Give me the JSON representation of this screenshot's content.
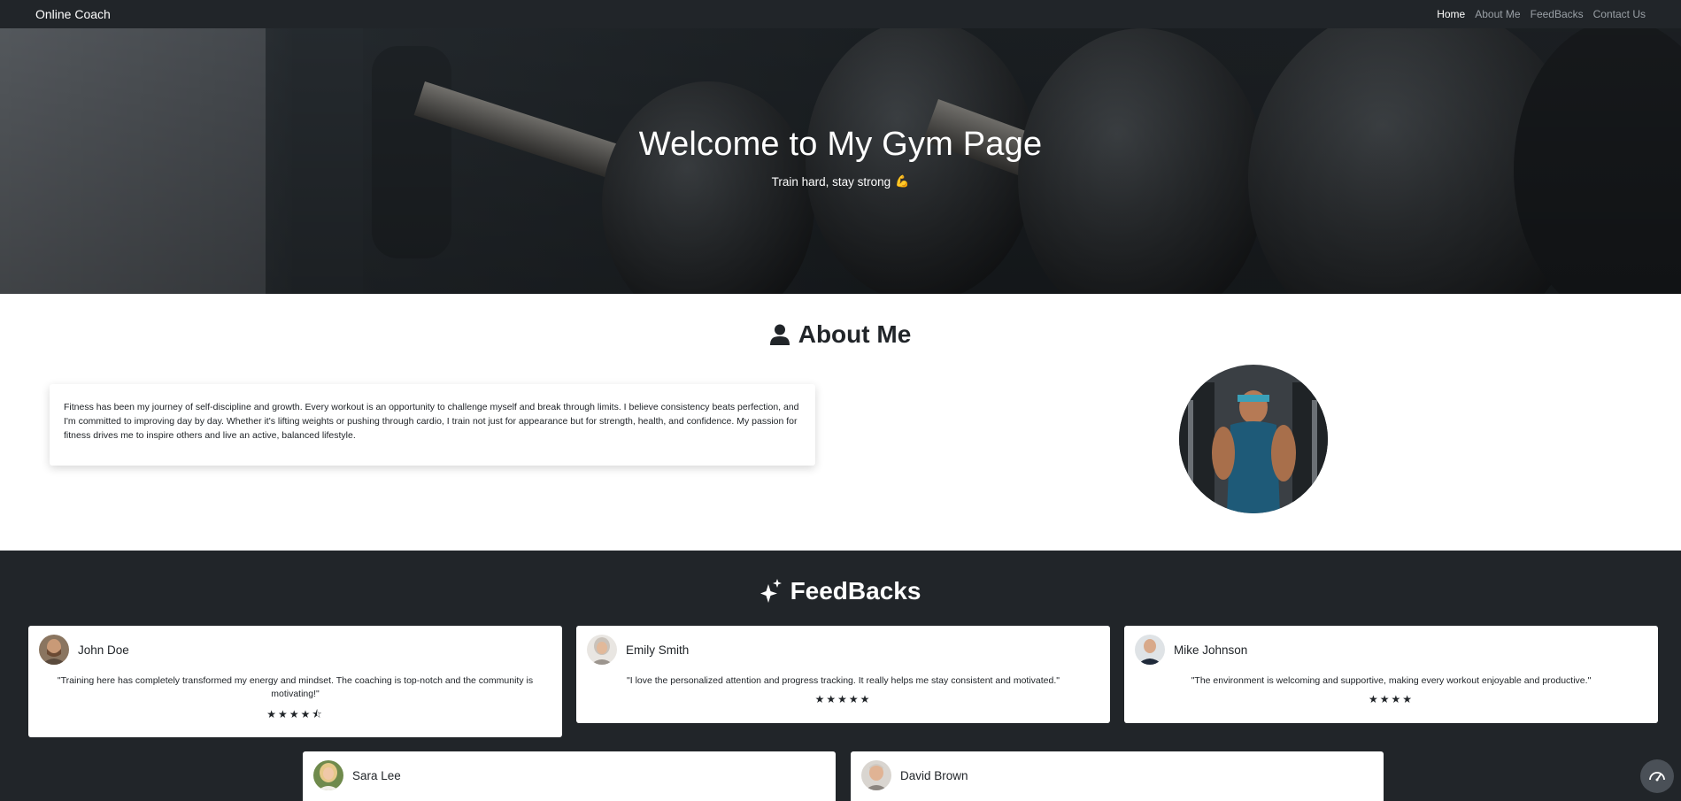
{
  "nav": {
    "brand": "Online Coach",
    "links": [
      {
        "label": "Home",
        "active": true
      },
      {
        "label": "About Me",
        "active": false
      },
      {
        "label": "FeedBacks",
        "active": false
      },
      {
        "label": "Contact Us",
        "active": false
      }
    ]
  },
  "hero": {
    "title": "Welcome to My Gym Page",
    "subtitle": "Train hard, stay strong",
    "subtitle_emoji": "💪"
  },
  "about": {
    "title": "About Me",
    "icon": "user-icon",
    "text": "Fitness has been my journey of self-discipline and growth. Every workout is an opportunity to challenge myself and break through limits. I believe consistency beats perfection, and I'm committed to improving day by day. Whether it's lifting weights or pushing through cardio, I train not just for appearance but for strength, health, and confidence. My passion for fitness drives me to inspire others and live an active, balanced lifestyle."
  },
  "feedbacks": {
    "title": "FeedBacks",
    "icon": "sparkles-icon",
    "items": [
      {
        "name": "John Doe",
        "text": "\"Training here has completely transformed my energy and mindset. The coaching is top-notch and the community is motivating!\"",
        "rating": 4.5,
        "stars": "★★★★⯪"
      },
      {
        "name": "Emily Smith",
        "text": "\"I love the personalized attention and progress tracking. It really helps me stay consistent and motivated.\"",
        "rating": 5,
        "stars": "★★★★★"
      },
      {
        "name": "Mike Johnson",
        "text": "\"The environment is welcoming and supportive, making every workout enjoyable and productive.\"",
        "rating": 4,
        "stars": "★★★★"
      },
      {
        "name": "Sara Lee",
        "text": "",
        "stars": ""
      },
      {
        "name": "David Brown",
        "text": "",
        "stars": ""
      }
    ]
  },
  "colors": {
    "navbar_bg": "#212529",
    "feedback_bg": "#212529",
    "text": "#212529",
    "white": "#ffffff"
  }
}
